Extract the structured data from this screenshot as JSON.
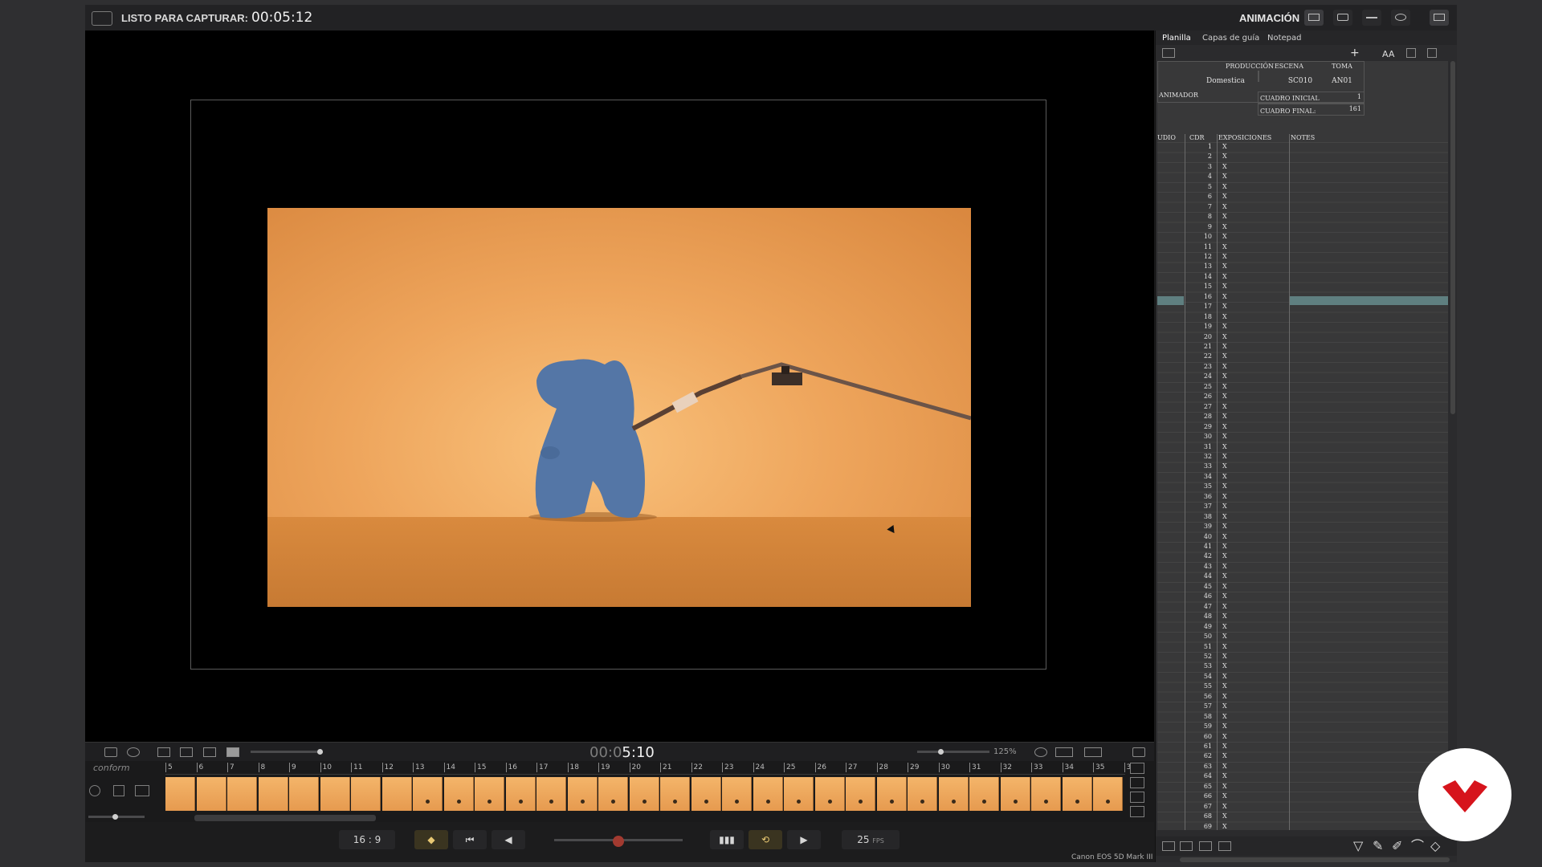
{
  "topbar": {
    "capture_label": "LISTO PARA CAPTURAR:",
    "capture_time": "00:05:12",
    "mode_label": "ANIMACIÓN",
    "mode_icons": [
      "monitor-icon",
      "camera-icon",
      "timeline-icon",
      "settings-icon",
      "window-icon"
    ]
  },
  "viewer": {
    "timecode_dim": "00:0",
    "timecode_main": "5:10",
    "zoom": "125%"
  },
  "timeline": {
    "track_label": "conform",
    "ticks": [
      "5",
      "6",
      "7",
      "8",
      "9",
      "10",
      "11",
      "12",
      "13",
      "14",
      "15",
      "16",
      "17",
      "18",
      "19",
      "20",
      "21",
      "22",
      "23",
      "24",
      "25",
      "26",
      "27",
      "28",
      "29",
      "30",
      "31",
      "32",
      "33",
      "34",
      "35",
      "3"
    ],
    "thumb_count": 31,
    "dot_from": 8
  },
  "transport": {
    "aspect": "16 : 9",
    "fps_value": "25",
    "fps_unit": "FPS",
    "onion_level": 0.5,
    "camera": "Canon EOS 5D Mark III"
  },
  "panel": {
    "tabs": [
      "Planilla",
      "Capas de guía",
      "Notepad"
    ],
    "produccion_label": "PRODUCCIÓN",
    "produccion_value": "Domestica",
    "escena_label": "ESCENA",
    "escena_value": "SC010",
    "toma_label": "TOMA",
    "toma_value": "AN01",
    "animador_label": "ANIMADOR",
    "cuadro_inicial_label": "CUADRO INICIAL",
    "cuadro_inicial_value": "1",
    "cuadro_final_label": "CUADRO FINAL:",
    "cuadro_final_value": "161",
    "col_audio": "UDIO",
    "col_cdr": "CDR",
    "col_exposiciones": "EXPOSICIONES",
    "col_notes": "NOTES",
    "row_count": 70,
    "exposure_mark": "X",
    "selected_row": 14
  }
}
